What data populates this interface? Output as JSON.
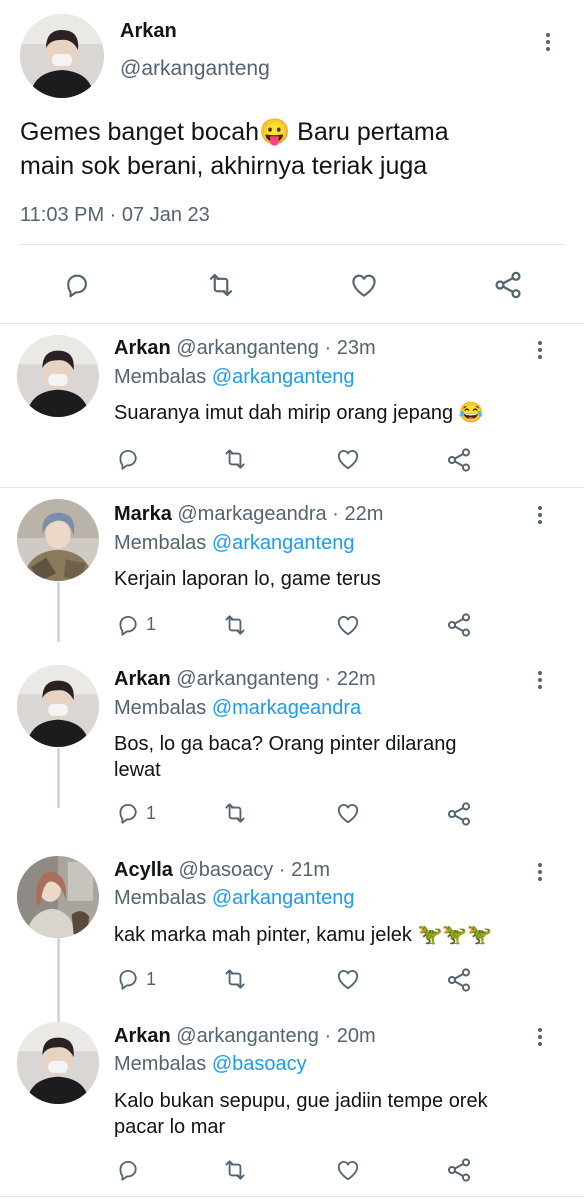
{
  "main_tweet": {
    "author_name": "Arkan",
    "handle": "@arkanganteng",
    "text_line1": "Gemes banget bocah",
    "emoji": "😛",
    "text_line1_rest": " Baru pertama",
    "text_line2": "main sok berani, akhirnya teriak juga",
    "timestamp": "11:03 PM · 07 Jan 23"
  },
  "replies": [
    {
      "author": "Arkan",
      "handle": "@arkanganteng",
      "sep": "·",
      "time": "23m",
      "replying_label": "Membalas",
      "replying_to": "@arkanganteng",
      "text1": "Suaranya imut dah mirip orang jepang 😂",
      "text2": "",
      "reply_count": ""
    },
    {
      "author": "Marka",
      "handle": "@markageandra",
      "sep": "·",
      "time": "22m",
      "replying_label": "Membalas",
      "replying_to": "@arkanganteng",
      "text1": "Kerjain laporan lo, game terus",
      "text2": "",
      "reply_count": "1"
    },
    {
      "author": "Arkan",
      "handle": "@arkanganteng",
      "sep": "·",
      "time": "22m",
      "replying_label": "Membalas",
      "replying_to": "@markageandra",
      "text1": "Bos, lo ga baca? Orang pinter dilarang",
      "text2": "lewat",
      "reply_count": "1"
    },
    {
      "author": "Acylla",
      "handle": "@basoacy",
      "sep": "·",
      "time": "21m",
      "replying_label": "Membalas",
      "replying_to": "@arkanganteng",
      "text1": "kak marka mah pinter, kamu jelek 🦖🦖🦖",
      "text2": "",
      "reply_count": "1"
    },
    {
      "author": "Arkan",
      "handle": "@arkanganteng",
      "sep": "·",
      "time": "20m",
      "replying_label": "Membalas",
      "replying_to": "@basoacy",
      "text1": "Kalo bukan sepupu, gue jadiin tempe orek",
      "text2": "pacar lo mar",
      "reply_count": ""
    }
  ],
  "icons": [
    "more-vertical-icon",
    "reply-icon",
    "retweet-icon",
    "like-icon",
    "share-icon"
  ],
  "colors": {
    "link": "#1d9bf0",
    "muted": "#536471",
    "text": "#0f1419",
    "divider": "#e3e6e8"
  }
}
